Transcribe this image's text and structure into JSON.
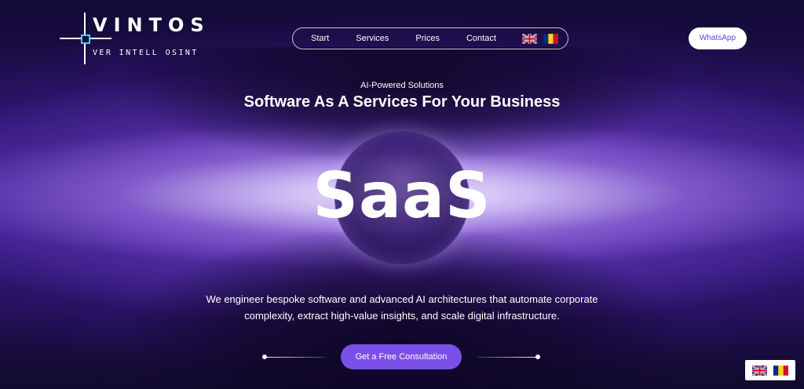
{
  "logo": {
    "brand": "VINTOS",
    "tagline": "VER INTELL OSINT"
  },
  "nav": {
    "items": [
      {
        "label": "Start"
      },
      {
        "label": "Services"
      },
      {
        "label": "Prices"
      },
      {
        "label": "Contact"
      }
    ],
    "flags": [
      "uk-flag-icon",
      "romania-flag-icon"
    ]
  },
  "header": {
    "whatsapp_label": "WhatsApp"
  },
  "hero": {
    "eyebrow": "AI-Powered Solutions",
    "headline": "Software As A Services For Your Business",
    "big_word": "SaaS",
    "description": "We engineer bespoke software and advanced AI architectures that automate corporate complexity, extract high-value insights, and scale digital infrastructure.",
    "cta_label": "Get a Free Consultation"
  },
  "colors": {
    "accent": "#7b4fe8",
    "background": "#140a32",
    "logo_square": "#3fd0f0"
  }
}
